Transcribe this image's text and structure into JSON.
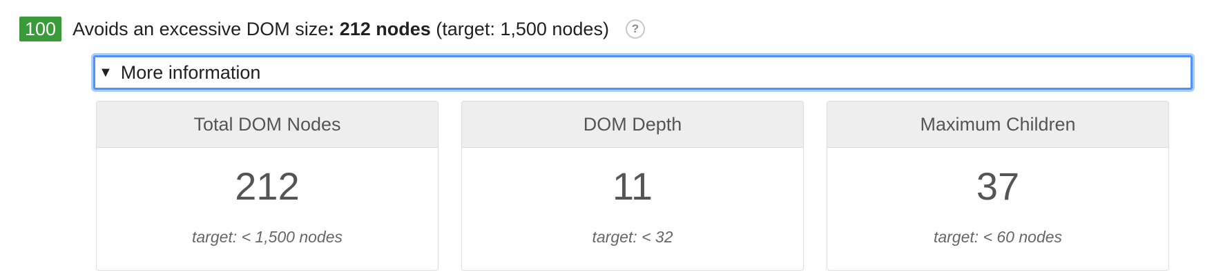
{
  "audit": {
    "score": "100",
    "title_prefix": "Avoids an excessive DOM size",
    "title_bold": ": 212 nodes",
    "title_suffix": " (target: 1,500 nodes)",
    "help_icon_label": "?"
  },
  "details": {
    "caret": "▼",
    "summary_label": "More information"
  },
  "cards": [
    {
      "header": "Total DOM Nodes",
      "value": "212",
      "target": "target: < 1,500 nodes"
    },
    {
      "header": "DOM Depth",
      "value": "11",
      "target": "target: < 32"
    },
    {
      "header": "Maximum Children",
      "value": "37",
      "target": "target: < 60 nodes"
    }
  ],
  "colors": {
    "score_pass": "#3a9a3a",
    "focus_ring": "#4d90fe",
    "card_header_bg": "#eeeeee"
  },
  "icons": [
    "help-icon",
    "caret-down-icon"
  ]
}
